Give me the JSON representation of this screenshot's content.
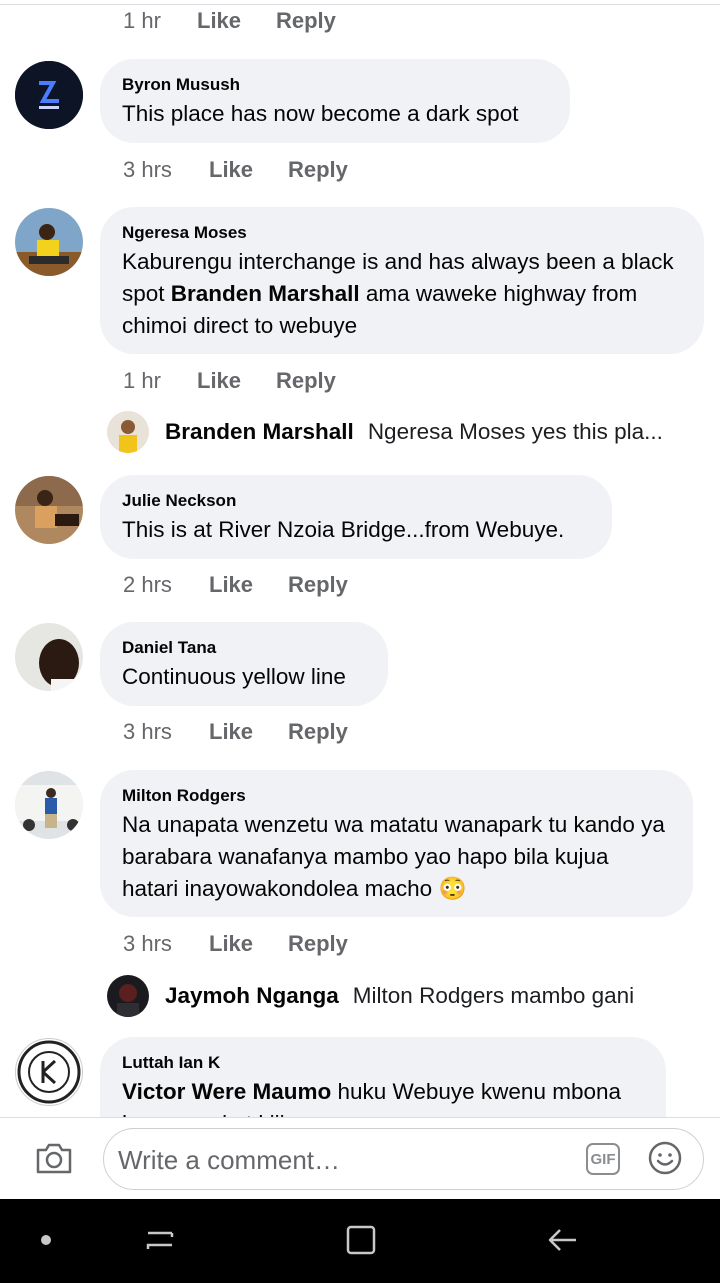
{
  "comments": [
    {
      "author": "",
      "time": "1 hr",
      "like": "Like",
      "reply": "Reply"
    },
    {
      "author": "Byron Musush",
      "text": "This place has now become a dark spot",
      "time": "3 hrs",
      "like": "Like",
      "reply": "Reply"
    },
    {
      "author": "Ngeresa Moses",
      "text_a": "Kaburengu interchange is and has always been a black spot ",
      "mention": "Branden Marshall",
      "text_b": " ama waweke highway from chimoi direct to webuye",
      "time": "1 hr",
      "like": "Like",
      "reply": "Reply"
    },
    {
      "author": "Julie Neckson",
      "text": "This is at River Nzoia Bridge...from Webuye.",
      "time": "2 hrs",
      "like": "Like",
      "reply": "Reply"
    },
    {
      "author": "Daniel Tana",
      "text": "Continuous yellow line",
      "time": "3 hrs",
      "like": "Like",
      "reply": "Reply"
    },
    {
      "author": "Milton Rodgers",
      "text": "Na unapata wenzetu wa matatu wanapark tu kando ya barabara wanafanya mambo yao hapo bila kujua hatari inayowakondolea macho 😳",
      "time": "3 hrs",
      "like": "Like",
      "reply": "Reply"
    },
    {
      "author": "Luttah Ian K",
      "mention": "Victor Were Maumo",
      "text": " huku Webuye kwenu mbona hau una ni ut kiji"
    }
  ],
  "replies": [
    {
      "author": "Branden Marshall",
      "text": "Ngeresa Moses yes this pla..."
    },
    {
      "author": "Jaymoh Nganga",
      "text": "Milton Rodgers mambo gani"
    }
  ],
  "composer": {
    "placeholder": "Write a comment…",
    "gif_label": "GIF",
    "icons": [
      "camera-icon",
      "gif-icon",
      "emoji-icon"
    ]
  },
  "navbar": {
    "icons": [
      "recent-apps-dot-icon",
      "recents-icon",
      "home-icon",
      "back-icon"
    ]
  },
  "colors": {
    "bubble": "#f0f2f5",
    "meta_text": "#65676b",
    "primary_text": "#050505",
    "navbar": "#000000"
  }
}
